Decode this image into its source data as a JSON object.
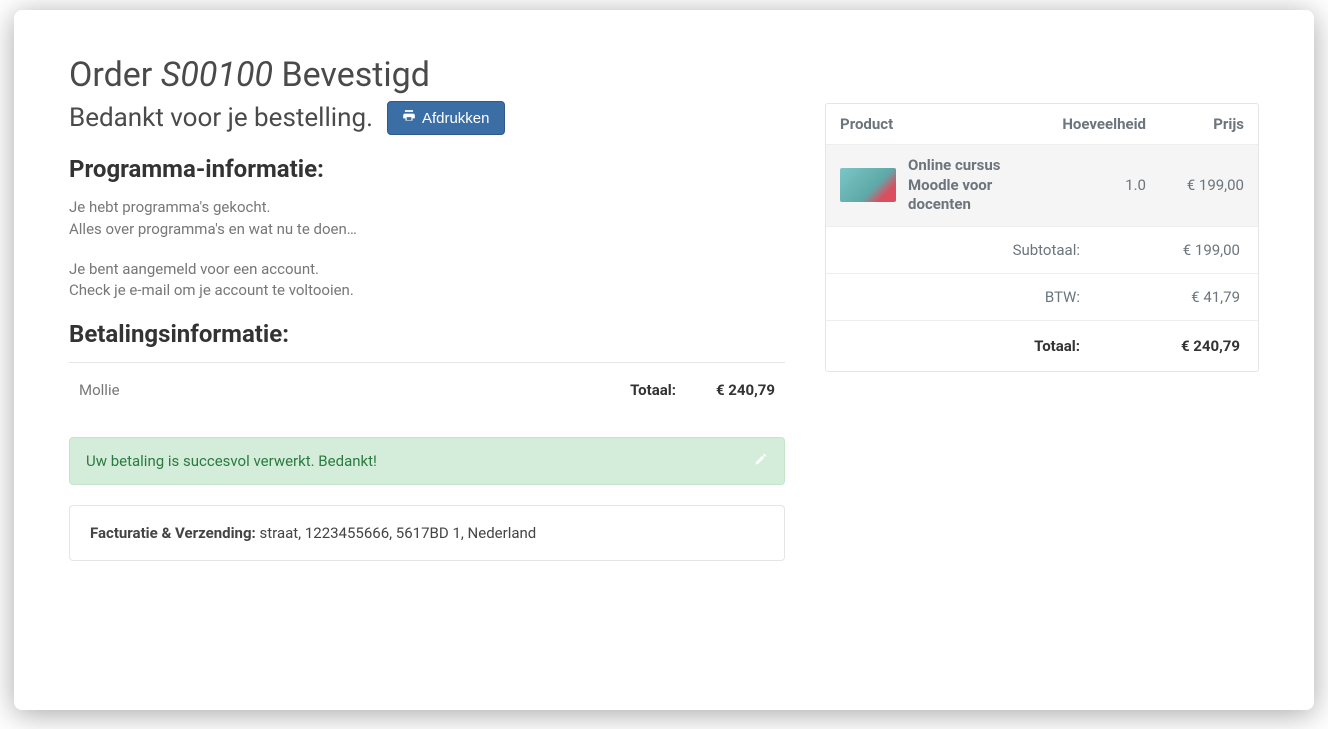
{
  "order": {
    "title_prefix": "Order",
    "number": "S00100",
    "title_suffix": "Bevestigd",
    "thank_you": "Bedankt voor je bestelling.",
    "print_label": "Afdrukken"
  },
  "program": {
    "heading": "Programma-informatie:",
    "line1": "Je hebt programma's gekocht.",
    "line2": "Alles over programma's en wat nu te doen…",
    "line3": "Je bent aangemeld voor een account.",
    "line4": "Check je e-mail om je account te voltooien."
  },
  "payment": {
    "heading": "Betalingsinformatie:",
    "provider": "Mollie",
    "total_label": "Totaal:",
    "total_value": "€ 240,79",
    "success_message": "Uw betaling is succesvol verwerkt. Bedankt!"
  },
  "shipping": {
    "label": "Facturatie & Verzending:",
    "address": "straat, 1223455666, 5617BD 1, Nederland"
  },
  "summary": {
    "header_product": "Product",
    "header_qty": "Hoeveelheid",
    "header_price": "Prijs",
    "line": {
      "name": "Online cursus Moodle voor docenten",
      "qty": "1.0",
      "price": "€ 199,00"
    },
    "subtotal_label": "Subtotaal:",
    "subtotal_value": "€ 199,00",
    "tax_label": "BTW:",
    "tax_value": "€ 41,79",
    "total_label": "Totaal:",
    "total_value": "€ 240,79"
  }
}
